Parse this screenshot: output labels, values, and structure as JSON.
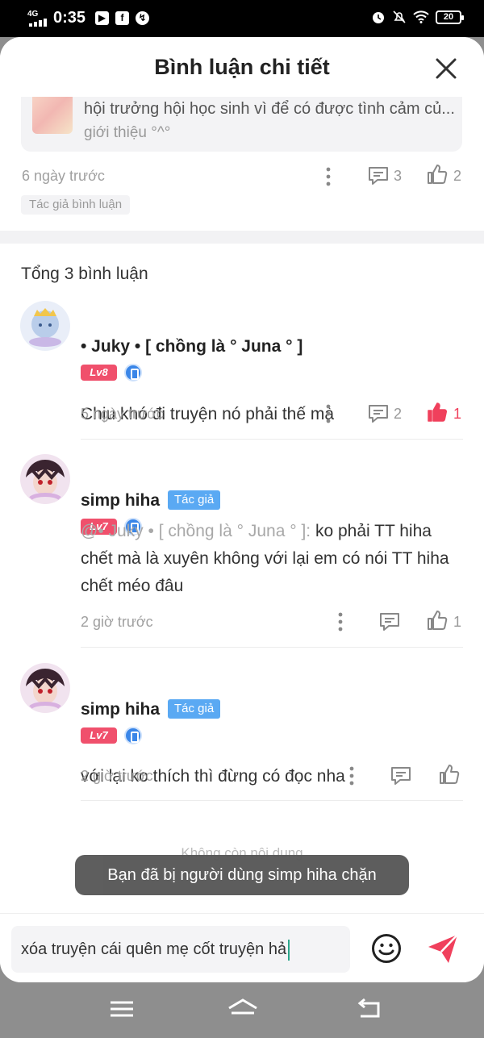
{
  "status_bar": {
    "network": "4G",
    "time": "0:35",
    "app_icons": [
      "youtube-icon",
      "facebook-icon",
      "messenger-icon"
    ],
    "battery": "20",
    "right_icons": [
      "alarm-icon",
      "mute-icon",
      "wifi-icon",
      "battery-icon"
    ]
  },
  "header": {
    "title": "Bình luận chi tiết"
  },
  "original_comment": {
    "quote_line1": "hội trưởng hội học sinh vì để có được tình cảm củ...",
    "quote_line2": "giới thiệu °^°",
    "time": "6 ngày trước",
    "reply_count": "3",
    "like_count": "2",
    "author_tag": "Tác giả bình luận"
  },
  "total_label": "Tổng 3 bình luận",
  "comments": [
    {
      "username": "• Juky • [ chồng là ° Juna ° ]",
      "level": "Lv8",
      "text": "Chịu khó đi truyện nó phải thế mà",
      "time": "5 ngày trước",
      "reply_count": "2",
      "like_count": "1",
      "liked": true
    },
    {
      "username": "simp hiha",
      "author_badge": "Tác giả",
      "level": "Lv7",
      "mention": "@• Juky • [ chồng là ° Juna ° ]:",
      "text": " ko phải TT hiha chết mà là xuyên không với lại em có nói TT hiha chết méo đâu",
      "time": "2 giờ trước",
      "like_count": "1"
    },
    {
      "username": "simp hiha",
      "author_badge": "Tác giả",
      "level": "Lv7",
      "text": "với lại ko thích thì đừng có đọc nha",
      "time": "2 giờ trước"
    }
  ],
  "no_more_label": "Không còn nội dung",
  "toast": "Bạn đã bị người dùng simp hiha chặn",
  "input": {
    "value": "xóa truyện cái quên mẹ cốt truyện hả"
  },
  "colors": {
    "like_active": "#f0405c",
    "author_badge": "#5aa9f3",
    "level_badge": "#f0506c"
  }
}
